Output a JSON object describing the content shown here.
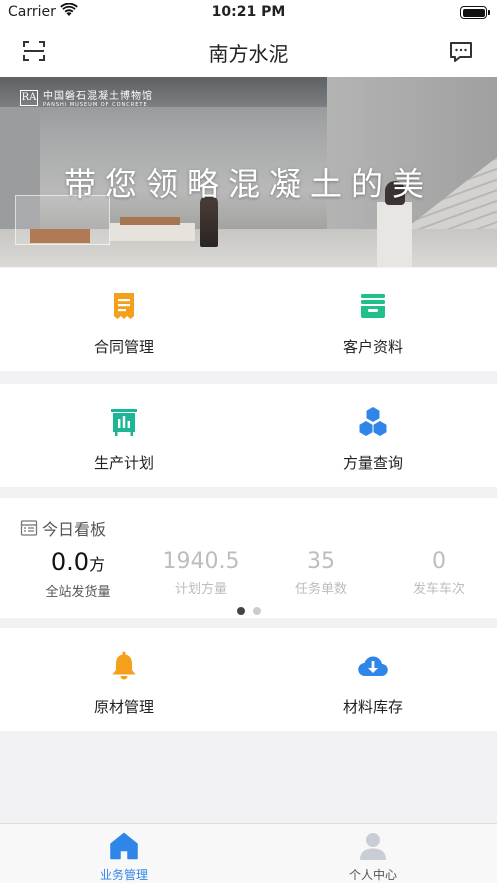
{
  "status_bar": {
    "carrier": "Carrier",
    "time": "10:21 PM"
  },
  "nav": {
    "title": "南方水泥"
  },
  "banner": {
    "logo_mark": "RA",
    "logo_cn": "中国磐石混凝土博物馆",
    "logo_en": "PANSHI MUSEUM OF CONCRETE",
    "slogan": "带您领略混凝土的美"
  },
  "menu_rows": [
    {
      "items": [
        {
          "label": "合同管理",
          "icon": "contract-icon",
          "color": "#f5a01d"
        },
        {
          "label": "客户资料",
          "icon": "customer-archive-icon",
          "color": "#20c08a"
        }
      ]
    },
    {
      "items": [
        {
          "label": "生产计划",
          "icon": "production-plan-icon",
          "color": "#1cb595"
        },
        {
          "label": "方量查询",
          "icon": "volume-query-icon",
          "color": "#2f86e8"
        }
      ]
    },
    {
      "items": [
        {
          "label": "原材管理",
          "icon": "bell-icon",
          "color": "#f5a01d"
        },
        {
          "label": "材料库存",
          "icon": "cloud-download-icon",
          "color": "#2f86e8"
        }
      ]
    }
  ],
  "board": {
    "title": "今日看板",
    "stats": [
      {
        "value": "0.0",
        "unit": "方",
        "label": "全站发货量"
      },
      {
        "value": "1940.5",
        "unit": "",
        "label": "计划方量"
      },
      {
        "value": "35",
        "unit": "",
        "label": "任务单数"
      },
      {
        "value": "0",
        "unit": "",
        "label": "发车车次"
      }
    ],
    "page_dots": {
      "count": 2,
      "active": 1
    }
  },
  "tabbar": {
    "tabs": [
      {
        "label": "业务管理",
        "icon": "home-icon",
        "active": true
      },
      {
        "label": "个人中心",
        "icon": "profile-icon",
        "active": false
      }
    ],
    "active_color": "#2f86e8",
    "inactive_color": "#555555"
  }
}
